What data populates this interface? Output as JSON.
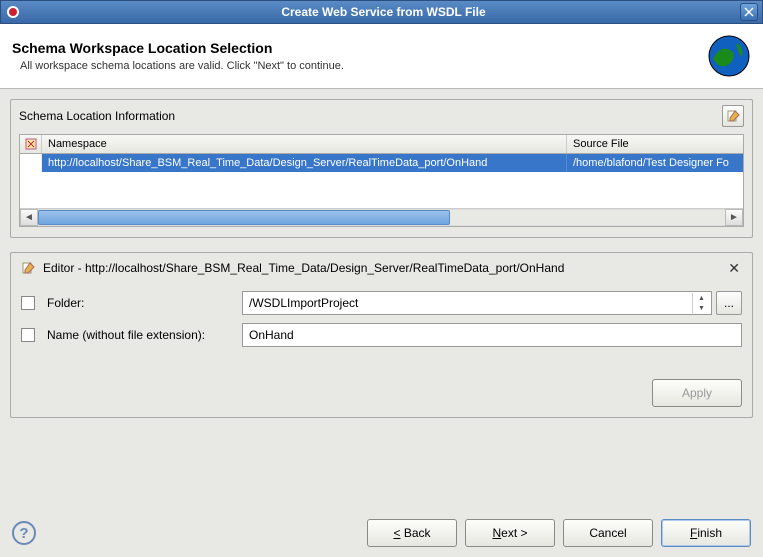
{
  "window": {
    "title": "Create Web Service from WSDL File"
  },
  "header": {
    "title": "Schema Workspace Location Selection",
    "subtitle": "All workspace schema locations are valid. Click \"Next\" to continue."
  },
  "schema_panel": {
    "title": "Schema Location Information",
    "columns": {
      "namespace": "Namespace",
      "source": "Source File"
    },
    "rows": [
      {
        "namespace": "http://localhost/Share_BSM_Real_Time_Data/Design_Server/RealTimeData_port/OnHand",
        "source": "/home/blafond/Test Designer Fo"
      }
    ]
  },
  "editor_panel": {
    "title": "Editor - http://localhost/Share_BSM_Real_Time_Data/Design_Server/RealTimeData_port/OnHand",
    "folder_label": "Folder:",
    "folder_value": "/WSDLImportProject",
    "name_label": "Name (without file extension):",
    "name_value": "OnHand",
    "apply_label": "Apply",
    "browse_label": "..."
  },
  "footer": {
    "back": "< Back",
    "next": "Next >",
    "cancel": "Cancel",
    "finish": "Finish"
  }
}
